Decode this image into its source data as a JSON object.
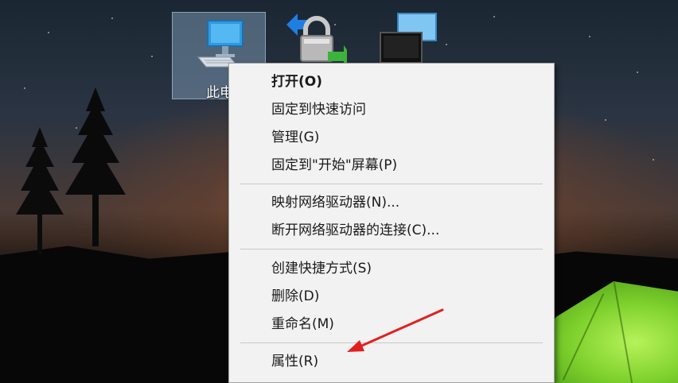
{
  "desktop": {
    "icons": [
      {
        "label": "此电",
        "icon": "computer-icon"
      },
      {
        "label": "",
        "icon": "network-lock-icon"
      },
      {
        "label": "",
        "icon": "network-computers-icon"
      }
    ]
  },
  "context_menu": {
    "items": [
      {
        "label": "打开(O)"
      },
      {
        "label": "固定到快速访问"
      },
      {
        "label": "管理(G)"
      },
      {
        "label": "固定到\"开始\"屏幕(P)"
      },
      {
        "label": "映射网络驱动器(N)..."
      },
      {
        "label": "断开网络驱动器的连接(C)..."
      },
      {
        "label": "创建快捷方式(S)"
      },
      {
        "label": "删除(D)"
      },
      {
        "label": "重命名(M)"
      },
      {
        "label": "属性(R)"
      }
    ]
  },
  "annotation": {
    "color": "#e02020",
    "icon": "red-arrow-annotation"
  }
}
